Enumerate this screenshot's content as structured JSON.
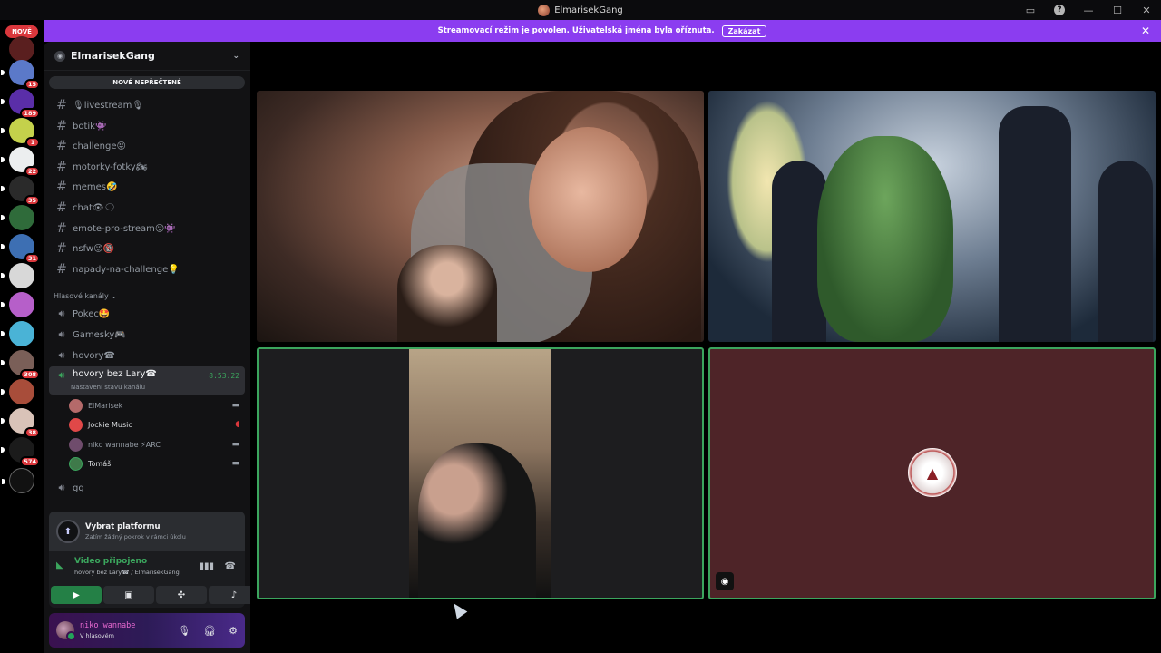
{
  "window": {
    "title": "ElmarisekGang"
  },
  "banner": {
    "text": "Streamovací režim je povolen. Uživatelská jména byla oříznuta.",
    "button": "Zakázat"
  },
  "guilds": {
    "new_label": "NOVĚ",
    "items": [
      {
        "badge": ""
      },
      {
        "badge": "15"
      },
      {
        "badge": "189"
      },
      {
        "badge": "1"
      },
      {
        "badge": "22"
      },
      {
        "badge": "35"
      },
      {
        "badge": ""
      },
      {
        "badge": "31"
      },
      {
        "badge": ""
      },
      {
        "badge": ""
      },
      {
        "badge": ""
      },
      {
        "badge": "308"
      },
      {
        "badge": ""
      },
      {
        "badge": "38"
      },
      {
        "badge": "574"
      },
      {
        "badge": ""
      }
    ]
  },
  "server": {
    "name": "ElmarisekGang",
    "unread_label": "NOVÉ NEPŘEČTENÉ",
    "text_channels": [
      {
        "name": "🎙livestream🎙"
      },
      {
        "name": "botik👾"
      },
      {
        "name": "challenge😝"
      },
      {
        "name": "motorky-fotky🏍"
      },
      {
        "name": "memes🤣"
      },
      {
        "name": "chat👁🗨"
      },
      {
        "name": "emote-pro-stream😜👾"
      },
      {
        "name": "nsfw😜🔞"
      },
      {
        "name": "napady-na-challenge💡"
      }
    ],
    "voice_section": "Hlasové kanály",
    "voice_channels": [
      {
        "name": "Pokec🤩"
      },
      {
        "name": "Gamesky🎮"
      },
      {
        "name": "hovory☎"
      },
      {
        "name": "hovory bez Lary☎",
        "timer": "8:53:22",
        "status": "Nastavení stavu kanálu"
      },
      {
        "name": "gg"
      }
    ],
    "voice_users": [
      {
        "name": "ElMarisek"
      },
      {
        "name": "Jockie Music"
      },
      {
        "name": "niko wannabe ⚡ARC"
      },
      {
        "name": "Tomáš"
      }
    ]
  },
  "quest": {
    "title": "Vybrat platformu",
    "subtitle": "Zatím žádný pokrok v rámci úkolu"
  },
  "voice_panel": {
    "status": "Video připojeno",
    "location": "hovory bez Lary☎ / ElmarisekGang"
  },
  "user": {
    "name": "niko wannabe",
    "status": "V hlasovém"
  },
  "colors": {
    "banner": "#8b3df0",
    "connected": "#3ba55d",
    "mention": "#da373c"
  }
}
